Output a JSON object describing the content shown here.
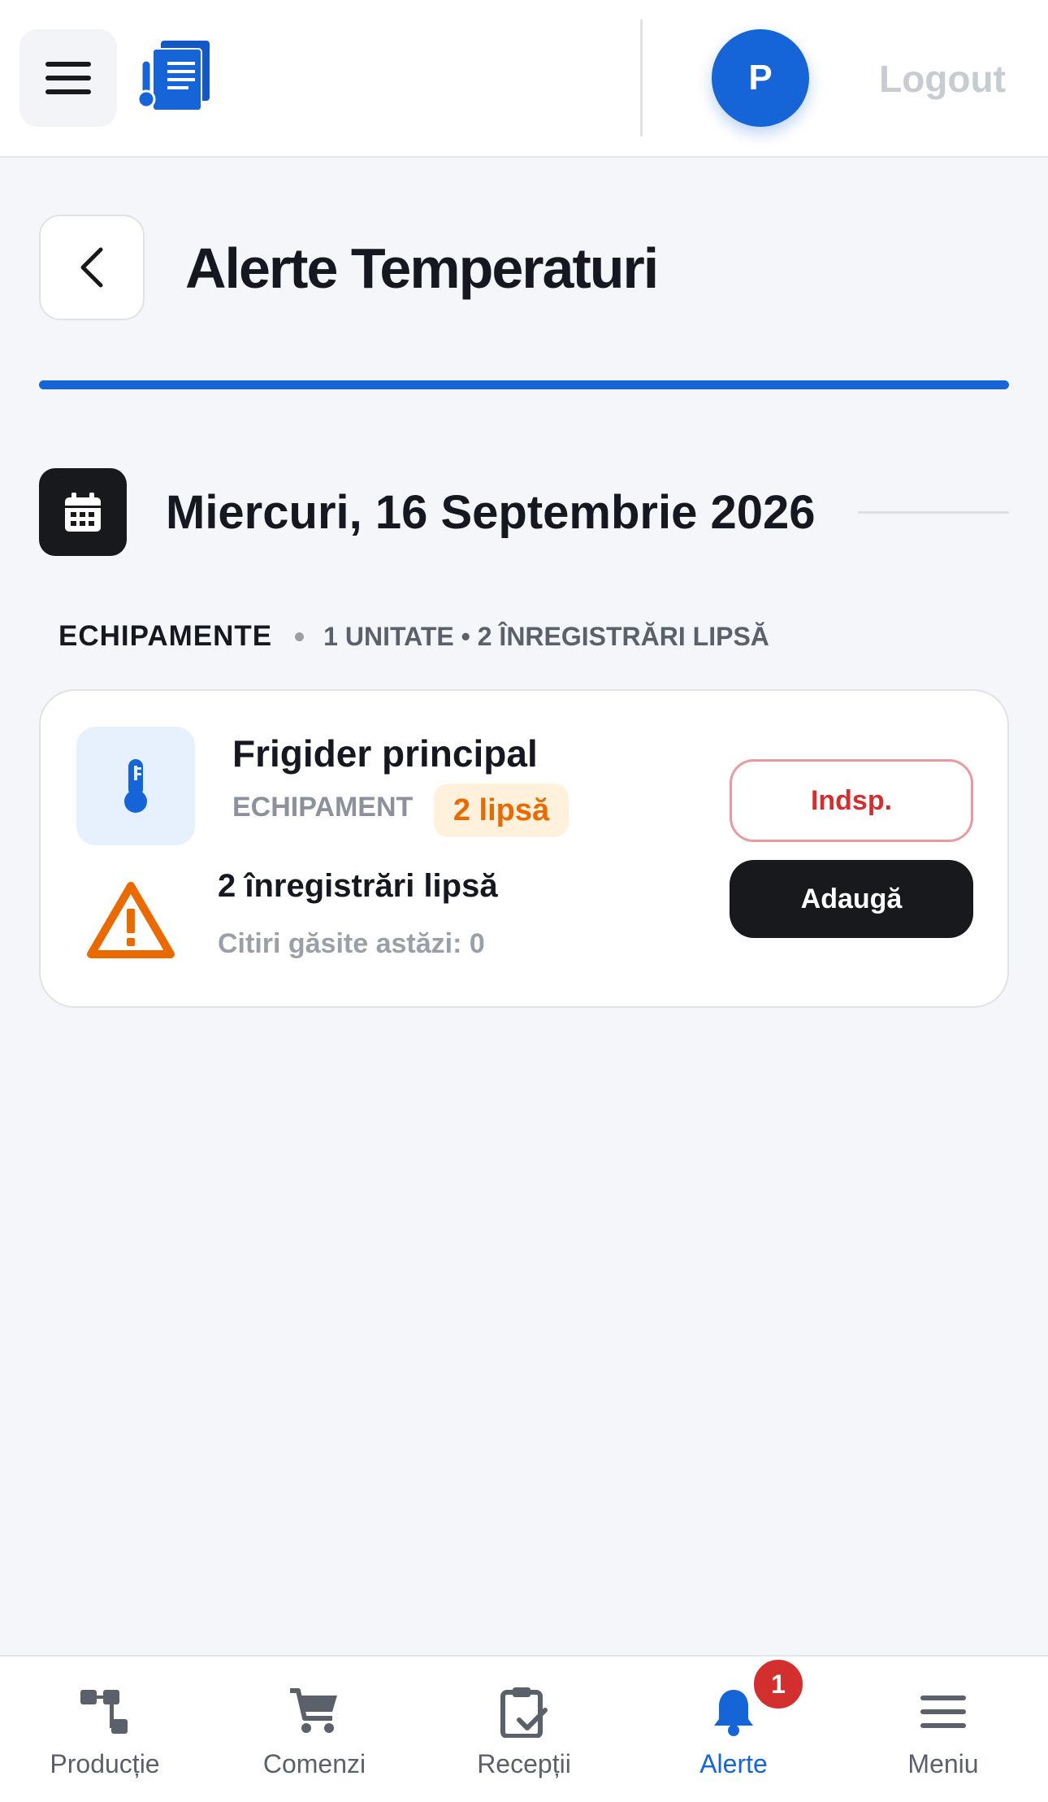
{
  "header": {
    "avatar_initial": "P",
    "logout_label": "Logout"
  },
  "page": {
    "title": "Alerte Temperaturi"
  },
  "date": {
    "label": "Miercuri, 16 Septembrie 2026"
  },
  "section": {
    "title": "ECHIPAMENTE",
    "meta": "1 UNITATE • 2 ÎNREGISTRĂRI LIPSĂ"
  },
  "equipment": [
    {
      "name": "Frigider principal",
      "type": "ECHIPAMENT",
      "missing_badge": "2 lipsă",
      "missing_title": "2 înregistrări lipsă",
      "readings_text": "Citiri găsite astăzi: 0",
      "unavailable_label": "Indsp.",
      "add_label": "Adaugă"
    }
  ],
  "bottom_nav": {
    "items": [
      {
        "label": "Producție",
        "icon": "production-icon"
      },
      {
        "label": "Comenzi",
        "icon": "cart-icon"
      },
      {
        "label": "Recepții",
        "icon": "clipboard-check-icon"
      },
      {
        "label": "Alerte",
        "icon": "bell-icon",
        "badge": "1",
        "active": true
      },
      {
        "label": "Meniu",
        "icon": "menu-icon"
      }
    ]
  },
  "colors": {
    "primary": "#1565d8",
    "warning": "#ea6a00",
    "danger": "#d32f2f",
    "dark": "#17191d"
  }
}
